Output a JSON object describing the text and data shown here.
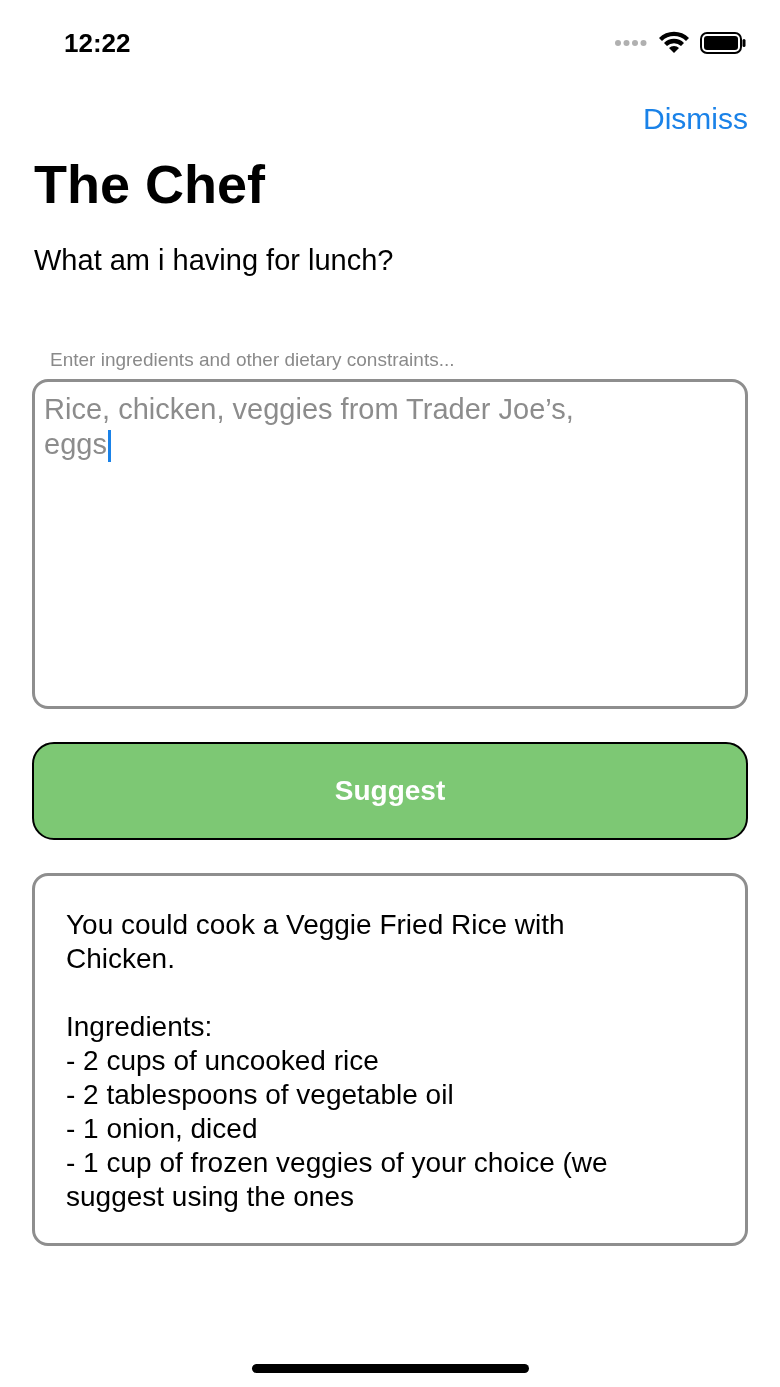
{
  "status_bar": {
    "time": "12:22"
  },
  "nav": {
    "dismiss": "Dismiss"
  },
  "title": "The Chef",
  "subtitle": "What am i having for lunch?",
  "field": {
    "label": "Enter ingredients and other dietary constraints...",
    "value": "Rice, chicken, veggies from Trader Joe’s, eggs",
    "focused": true
  },
  "suggest_button": "Suggest",
  "result": {
    "intro": "You could cook a Veggie Fried Rice with Chicken.",
    "heading": "Ingredients:",
    "items": [
      "- 2 cups of uncooked rice",
      "- 2 tablespoons of vegetable oil",
      "- 1 onion, diced",
      "- 1 cup of frozen veggies of your choice (we suggest using the ones"
    ]
  }
}
